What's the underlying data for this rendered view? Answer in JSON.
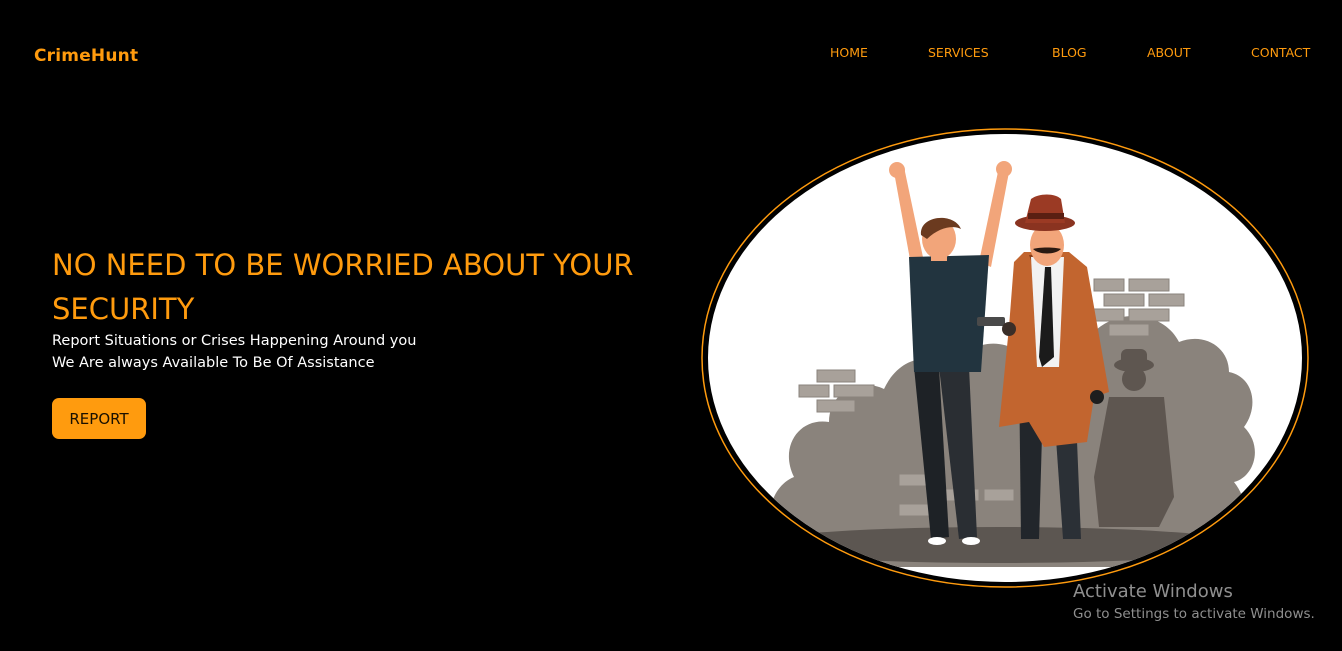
{
  "brand": {
    "name": "CrimeHunt",
    "accent_color": "#ff9b0e"
  },
  "nav": {
    "items": [
      {
        "label": "HOME"
      },
      {
        "label": "SERVICES"
      },
      {
        "label": "BLOG"
      },
      {
        "label": "ABOUT"
      },
      {
        "label": "CONTACT"
      }
    ]
  },
  "hero": {
    "title": "NO NEED TO BE WORRIED ABOUT YOUR SECURITY",
    "subtitle_line1": "Report Situations or Crises Happening Around you",
    "subtitle_line2": "We Are always Available To Be Of Assistance",
    "cta_label": "REPORT",
    "illustration_icon": "detective-arrest-illustration"
  },
  "watermark": {
    "title": "Activate Windows",
    "subtitle": "Go to Settings to activate Windows."
  }
}
